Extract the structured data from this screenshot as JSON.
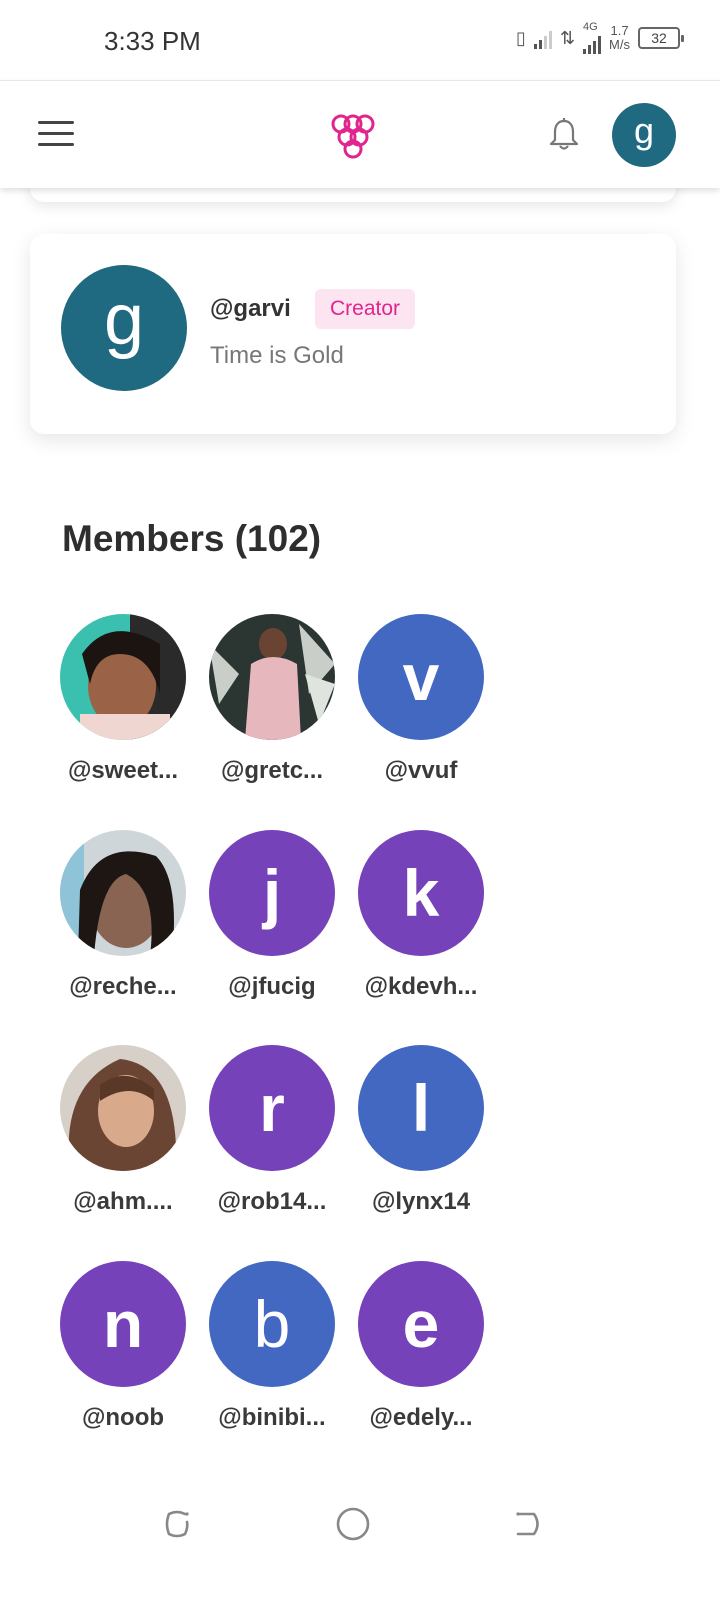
{
  "status_bar": {
    "time": "3:33 PM",
    "network_label": "4G",
    "speed_value": "1.7",
    "speed_unit": "M/s",
    "battery": "32"
  },
  "header": {
    "logo_icon": "grape-cluster-logo-icon",
    "avatar_letter": "g",
    "colors": {
      "avatar_bg": "#1f6a80",
      "logo": "#e0268e"
    }
  },
  "profile": {
    "avatar_letter": "g",
    "username": "@garvi",
    "badge": "Creator",
    "bio": "Time is Gold"
  },
  "members": {
    "title": "Members (102)",
    "items": [
      {
        "handle": "@sweet...",
        "type": "photo"
      },
      {
        "handle": "@gretc...",
        "type": "photo"
      },
      {
        "handle": "@vvuf",
        "type": "letter",
        "letter": "v",
        "color": "#4368c2"
      },
      {
        "handle": "@reche...",
        "type": "photo"
      },
      {
        "handle": "@jfucig",
        "type": "letter",
        "letter": "j",
        "color": "#7542b9"
      },
      {
        "handle": "@kdevh...",
        "type": "letter",
        "letter": "k",
        "color": "#7542b9"
      },
      {
        "handle": "@ahm....",
        "type": "photo"
      },
      {
        "handle": "@rob14...",
        "type": "letter",
        "letter": "r",
        "color": "#7542b9"
      },
      {
        "handle": "@lynx14",
        "type": "letter",
        "letter": "l",
        "color": "#4368c2"
      },
      {
        "handle": "@noob",
        "type": "letter",
        "letter": "n",
        "color": "#7542b9"
      },
      {
        "handle": "@binibi...",
        "type": "letter",
        "letter": "b",
        "color": "#4368c2"
      },
      {
        "handle": "@edely...",
        "type": "letter",
        "letter": "e",
        "color": "#7542b9"
      }
    ]
  }
}
